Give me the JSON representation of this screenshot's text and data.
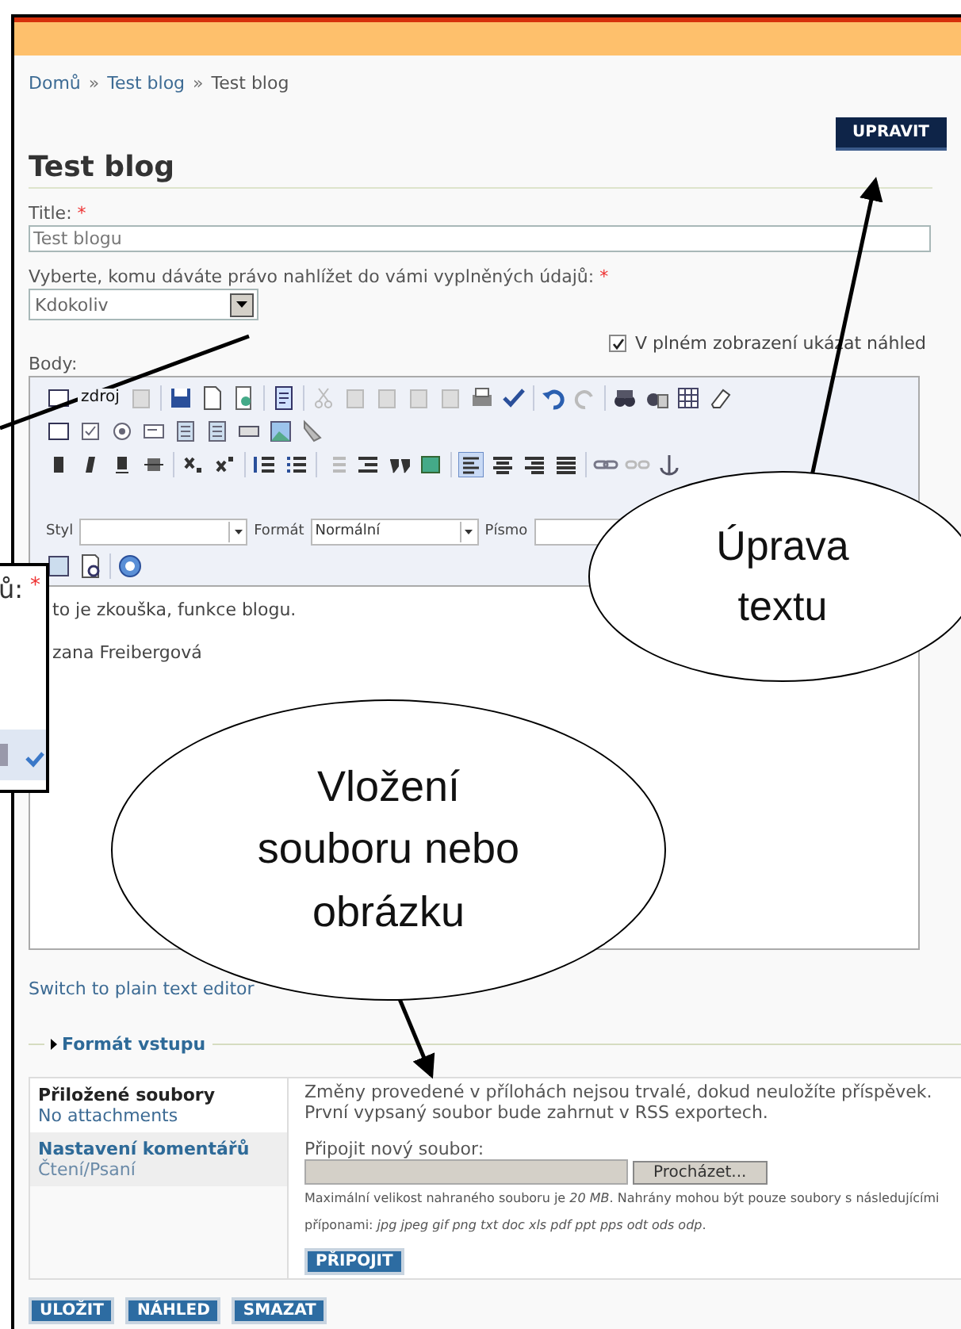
{
  "breadcrumb": {
    "separator": "»",
    "items": [
      {
        "label": "Domů",
        "link": true
      },
      {
        "label": "Test blog",
        "link": true
      },
      {
        "label": "Test blog",
        "link": false
      }
    ]
  },
  "edit_button": "UPRAVIT",
  "page_title": "Test blog",
  "form": {
    "title": {
      "label": "Title:",
      "required_mark": "*",
      "value": "Test blogu"
    },
    "visibility": {
      "label": "Vyberte, komu dáváte právo nahlížet do vámi vyplněných údajů:",
      "required_mark": "*",
      "value": "Kdokoliv"
    },
    "preview_option": {
      "label": "V plném zobrazení ukázat náhled",
      "checked": true
    },
    "body": {
      "label": "Body:",
      "source_label": "zdroj",
      "selects": [
        {
          "label": "Styl"
        },
        {
          "label": "Formát",
          "value": "Normální"
        },
        {
          "label": "Písmo"
        }
      ],
      "content": [
        "to je zkouška, funkce blogu.",
        "zana Freibergová"
      ]
    },
    "switch_link": "Switch to plain text editor",
    "input_format": "Formát vstupu"
  },
  "attachments": {
    "tabs": [
      {
        "title": "Přiložené soubory",
        "summary": "No attachments",
        "selected": true
      },
      {
        "title": "Nastavení komentářů",
        "summary": "Čtení/Psaní",
        "selected": false
      }
    ],
    "notice": "Změny provedené v přílohách nejsou trvalé, dokud neuložíte příspěvek. První vypsaný soubor bude zahrnut v RSS exportech.",
    "new_file_label": "Připojit nový soubor:",
    "browse_button": "Procházet...",
    "help": "Maximální velikost nahraného souboru je *20 MB*. Nahrány mohou být pouze soubory s následujícími příponami: *jpg jpeg gif png txt doc xls pdf ppt pps odt ods odp*.",
    "attach_button": "PŘIPOJIT"
  },
  "actions": [
    "ULOŽIT",
    "NÁHLED",
    "SMAZAT"
  ],
  "inset": {
    "label_fragment": "ů:",
    "required_mark": "*"
  },
  "callouts": [
    {
      "lines": [
        "Úprava",
        "textu"
      ]
    },
    {
      "lines": [
        "Vložení",
        "souboru nebo",
        "obrázku"
      ]
    }
  ]
}
